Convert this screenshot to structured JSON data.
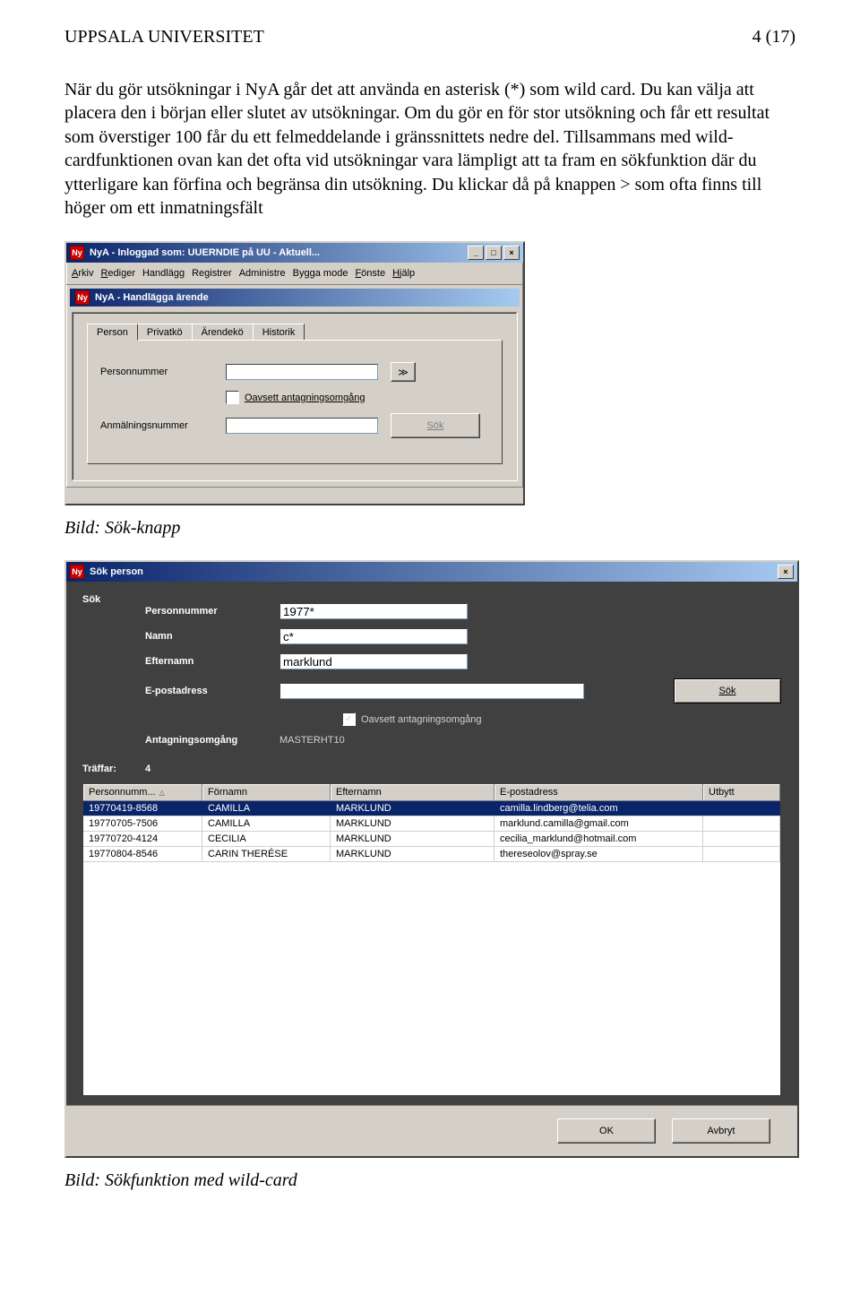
{
  "header": {
    "org": "UPPSALA UNIVERSITET",
    "page": "4 (17)"
  },
  "paragraph": "När du gör utsökningar i NyA går det att använda en asterisk (*) som wild card. Du kan välja att placera den i början eller slutet av utsökningar. Om du gör en för stor utsökning och får ett resultat som överstiger 100 får du ett felmeddelande i gränssnittets nedre del. Tillsammans med wild-cardfunktionen ovan kan det ofta vid utsökningar vara lämpligt att ta fram en sökfunktion där du ytterligare kan förfina och begränsa din utsökning. Du klickar då på knappen > som ofta finns till höger om ett inmatningsfält",
  "caption1": "Bild: Sök-knapp",
  "caption2": "Bild: Sökfunktion med wild-card",
  "win1": {
    "title": "NyA - Inloggad som: UUERNDIE på UU - Aktuell...",
    "menus": [
      "Arkiv",
      "Redigera",
      "Handlägga",
      "Registrera",
      "Administrera",
      "Bygga modell",
      "Fönster",
      "Hjälp"
    ],
    "subtitle": "NyA - Handlägga ärende",
    "tabs": [
      "Person",
      "Privatkö",
      "Ärendekö",
      "Historik"
    ],
    "active_tab": 0,
    "labels": {
      "personnummer": "Personnummer",
      "anmalningsnummer": "Anmälningsnummer",
      "checkbox": "Oavsett antagningsomgång",
      "sok": "Sök",
      "arrow": "≫"
    }
  },
  "win2": {
    "title": "Sök person",
    "search_label": "Sök",
    "fields": {
      "personnummer": {
        "label": "Personnummer",
        "value": "1977*"
      },
      "namn": {
        "label": "Namn",
        "value": "c*"
      },
      "efternamn": {
        "label": "Efternamn",
        "value": "marklund"
      },
      "epost": {
        "label": "E-postadress",
        "value": ""
      }
    },
    "sok": "Sök",
    "checkbox": "Oavsett antagningsomgång",
    "checkbox_checked": true,
    "omgang": {
      "label": "Antagningsomgång",
      "value": "MASTERHT10"
    },
    "hits": {
      "label": "Träffar:",
      "value": "4"
    },
    "columns": [
      "Personnumm...",
      "Förnamn",
      "Efternamn",
      "E-postadress",
      "Utbytt"
    ],
    "rows": [
      {
        "pnr": "19770419-8568",
        "fn": "CAMILLA",
        "en": "MARKLUND",
        "email": "camilla.lindberg@telia.com",
        "utbytt": ""
      },
      {
        "pnr": "19770705-7506",
        "fn": "CAMILLA",
        "en": "MARKLUND",
        "email": "marklund.camilla@gmail.com",
        "utbytt": ""
      },
      {
        "pnr": "19770720-4124",
        "fn": "CECILIA",
        "en": "MARKLUND",
        "email": "cecilia_marklund@hotmail.com",
        "utbytt": ""
      },
      {
        "pnr": "19770804-8546",
        "fn": "CARIN THERÉSE",
        "en": "MARKLUND",
        "email": "thereseolov@spray.se",
        "utbytt": ""
      }
    ],
    "selected_row": 0,
    "buttons": {
      "ok": "OK",
      "cancel": "Avbryt"
    }
  }
}
